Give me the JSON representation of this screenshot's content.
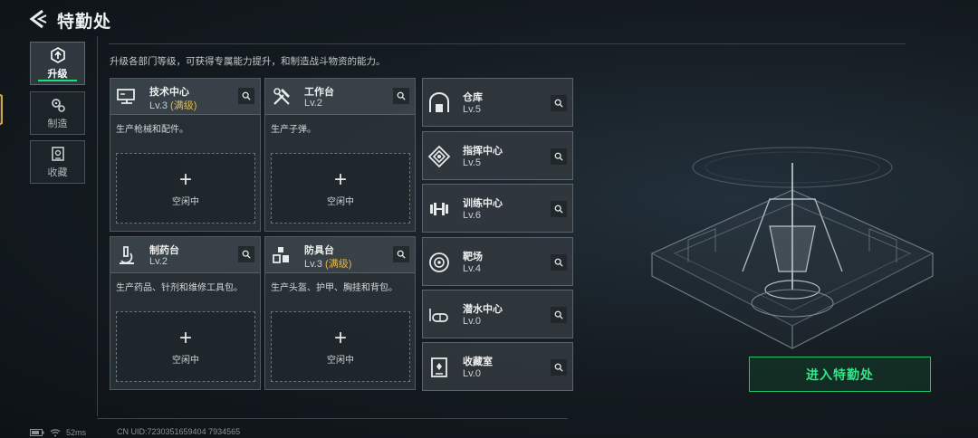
{
  "header": {
    "title": "特勤处"
  },
  "side_tabs": [
    {
      "label": "升级",
      "icon": "upgrade-icon",
      "active": true
    },
    {
      "label": "制造",
      "icon": "gears-icon",
      "active": false
    },
    {
      "label": "收藏",
      "icon": "collection-icon",
      "active": false
    }
  ],
  "description": "升级各部门等级，可获得专属能力提升，和制造战斗物资的能力。",
  "big_cards": [
    {
      "name": "技术中心",
      "level": "Lv.3",
      "maxed": "(满级)",
      "desc": "生产枪械和配件。",
      "slot": "空闲中",
      "icon": "monitor-icon"
    },
    {
      "name": "工作台",
      "level": "Lv.2",
      "maxed": "",
      "desc": "生产子弹。",
      "slot": "空闲中",
      "icon": "tools-icon"
    },
    {
      "name": "制药台",
      "level": "Lv.2",
      "maxed": "",
      "desc": "生产药品、针剂和维修工具包。",
      "slot": "空闲中",
      "icon": "microscope-icon"
    },
    {
      "name": "防具台",
      "level": "Lv.3",
      "maxed": "(满级)",
      "desc": "生产头盔、护甲、胸挂和背包。",
      "slot": "空闲中",
      "icon": "boxes-icon"
    }
  ],
  "small_cards": [
    {
      "name": "仓库",
      "level": "Lv.5",
      "icon": "warehouse-icon"
    },
    {
      "name": "指挥中心",
      "level": "Lv.5",
      "icon": "command-icon"
    },
    {
      "name": "训练中心",
      "level": "Lv.6",
      "icon": "dumbbell-icon"
    },
    {
      "name": "靶场",
      "level": "Lv.4",
      "icon": "target-icon"
    },
    {
      "name": "潜水中心",
      "level": "Lv.0",
      "icon": "diving-mask-icon"
    },
    {
      "name": "收藏室",
      "level": "Lv.0",
      "icon": "collection-room-icon"
    }
  ],
  "enter_button": "进入特勤处",
  "status": {
    "ping": "52ms",
    "uid": "CN UID:7230351659404 7934565"
  },
  "colors": {
    "accent": "#19e27a",
    "maxed": "#e6b84a"
  }
}
